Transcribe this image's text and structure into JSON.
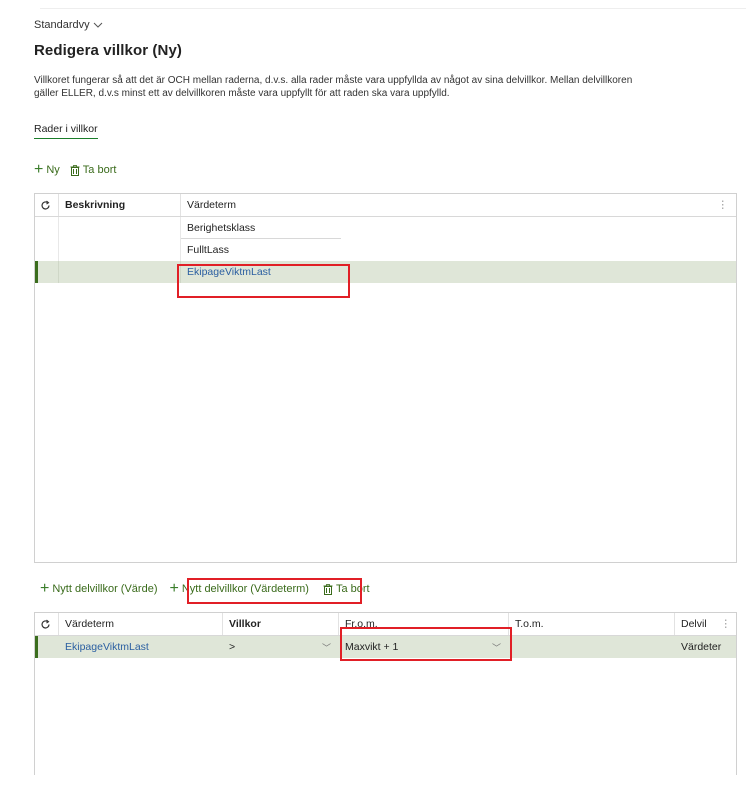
{
  "header": {
    "view_label": "Standardvy",
    "title": "Redigera villkor (Ny)",
    "description_line1": "Villkoret fungerar så att det är OCH mellan raderna, d.v.s. alla rader måste vara uppfyllda av något av sina delvillkor. Mellan delvillkoren",
    "description_line2": "gäller ELLER, d.v.s minst ett av delvillkoren måste vara uppfyllt för att raden ska vara uppfylld."
  },
  "tab": {
    "label": "Rader i villkor"
  },
  "toolbar1": {
    "new_label": "Ny",
    "delete_label": "Ta bort"
  },
  "grid1": {
    "col_description": "Beskrivning",
    "col_value_term": "Värdeterm",
    "rows": [
      {
        "description": "",
        "value_term": "Berighetsklass"
      },
      {
        "description": "",
        "value_term": "FulltLass"
      },
      {
        "description": "",
        "value_term": "EkipageViktmLast"
      }
    ]
  },
  "toolbar2": {
    "new_value_label": "Nytt delvillkor (Värde)",
    "new_valueterm_label": "Nytt delvillkor (Värdeterm)",
    "delete_label": "Ta bort"
  },
  "grid2": {
    "col_value_term": "Värdeterm",
    "col_condition": "Villkor",
    "col_from": "Fr.o.m.",
    "col_to": "T.o.m.",
    "col_subcondition": "Delvil",
    "row": {
      "value_term": "EkipageViktmLast",
      "condition": ">",
      "from": "Maxvikt + 1",
      "to": "",
      "subcondition": "Värdeter"
    }
  },
  "colors": {
    "accent": "#3a6b1b",
    "selection": "#dfe6d8",
    "highlight_box": "#e11f26",
    "link": "#2b5fa1"
  }
}
